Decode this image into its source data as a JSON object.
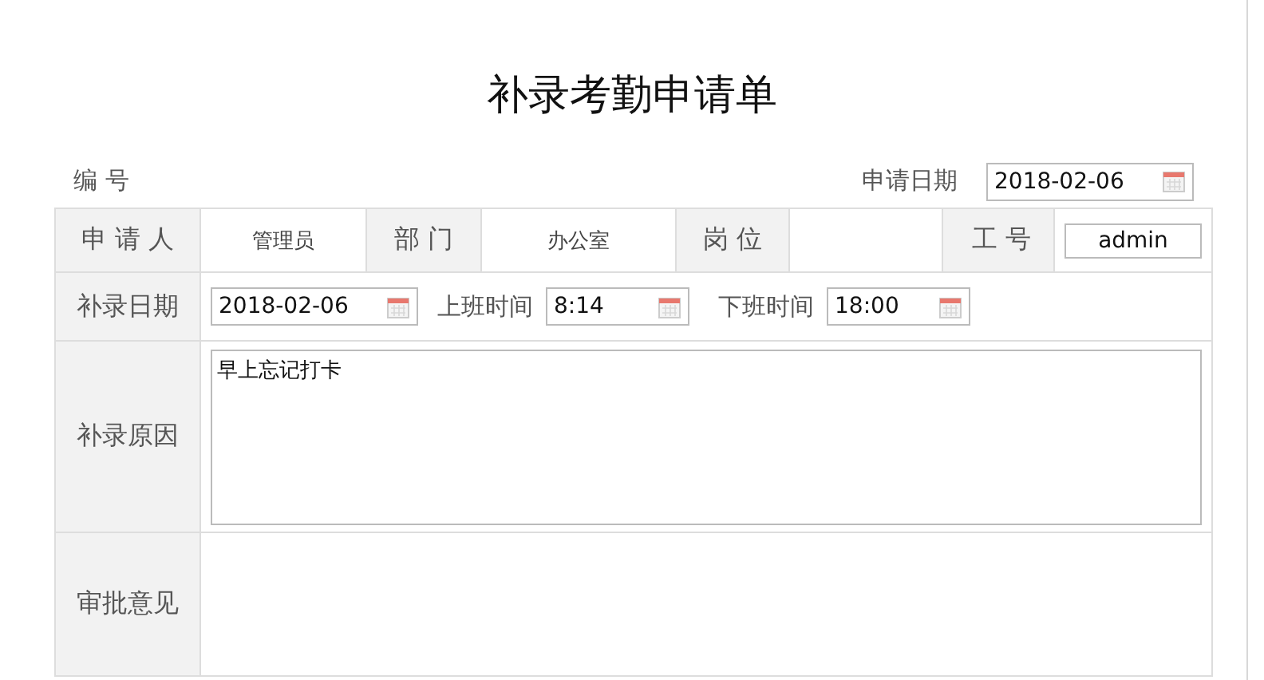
{
  "title": "补录考勤申请单",
  "header": {
    "number_label": "编 号",
    "date_label": "申请日期",
    "date_value": "2018-02-06"
  },
  "applicant_row": [
    {
      "label": "申 请 人",
      "kind": "text",
      "value": "管理员"
    },
    {
      "label": "部 门",
      "kind": "text",
      "value": "办公室"
    },
    {
      "label": "岗 位",
      "kind": "text"
    },
    {
      "label": "工 号",
      "kind": "input",
      "value": "admin"
    }
  ],
  "date_row": {
    "label": "补录日期",
    "items": [
      {
        "value": "2018-02-06"
      },
      {
        "caption": "上班时间",
        "value": "8:14"
      },
      {
        "caption": "下班时间",
        "value": "18:00"
      }
    ]
  },
  "reason": {
    "label": "补录原因",
    "value": "早上忘记打卡"
  },
  "approval": {
    "label": "审批意见"
  }
}
